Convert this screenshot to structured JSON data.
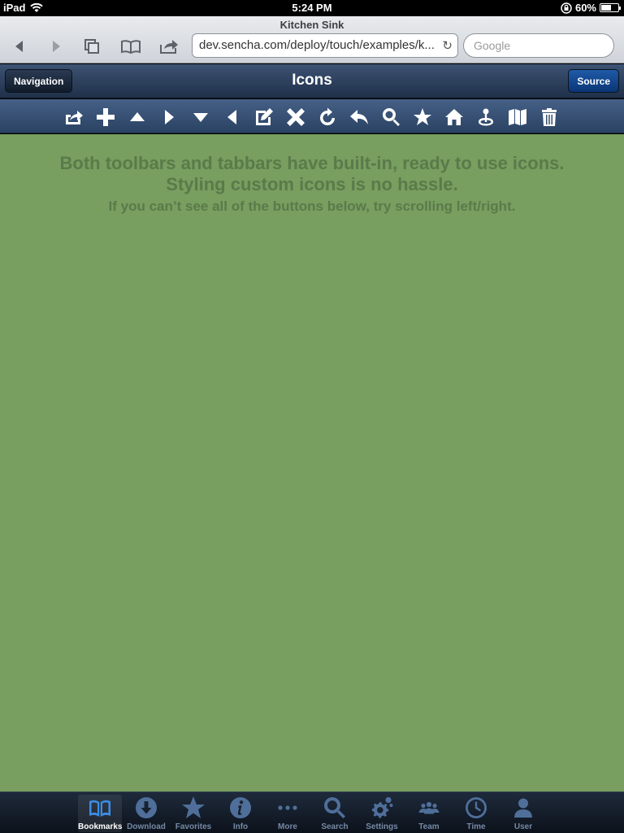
{
  "status": {
    "device": "iPad",
    "time": "5:24 PM",
    "battery": "60%",
    "battery_level": 0.6
  },
  "safari": {
    "title": "Kitchen Sink",
    "url": "dev.sencha.com/deploy/touch/examples/k...",
    "search_placeholder": "Google"
  },
  "titlebar": {
    "title": "Icons",
    "nav_label": "Navigation",
    "source_label": "Source"
  },
  "toolbar_icons": [
    "action-icon",
    "add-icon",
    "arrow-up-icon",
    "arrow-right-icon",
    "arrow-down-icon",
    "arrow-left-icon",
    "compose-icon",
    "delete-icon",
    "refresh-icon",
    "reply-icon",
    "search-icon",
    "star-icon",
    "home-icon",
    "locate-icon",
    "maps-icon",
    "trash-icon"
  ],
  "content": {
    "line1": "Both toolbars and tabbars have built-in, ready to use icons.",
    "line2": "Styling custom icons is no hassle.",
    "line3": "If you can’t see all of the buttons below, try scrolling left/right."
  },
  "tabs": [
    {
      "label": "Bookmarks",
      "icon": "bookmarks-icon",
      "active": true
    },
    {
      "label": "Download",
      "icon": "download-icon"
    },
    {
      "label": "Favorites",
      "icon": "favorites-icon"
    },
    {
      "label": "Info",
      "icon": "info-icon"
    },
    {
      "label": "More",
      "icon": "more-icon"
    },
    {
      "label": "Search",
      "icon": "search-icon"
    },
    {
      "label": "Settings",
      "icon": "settings-icon"
    },
    {
      "label": "Team",
      "icon": "team-icon"
    },
    {
      "label": "Time",
      "icon": "time-icon"
    },
    {
      "label": "User",
      "icon": "user-icon"
    }
  ],
  "colors": {
    "content_bg": "#789e60",
    "titlebar": "#2f4360",
    "active_tab": "#3b8ee6"
  }
}
